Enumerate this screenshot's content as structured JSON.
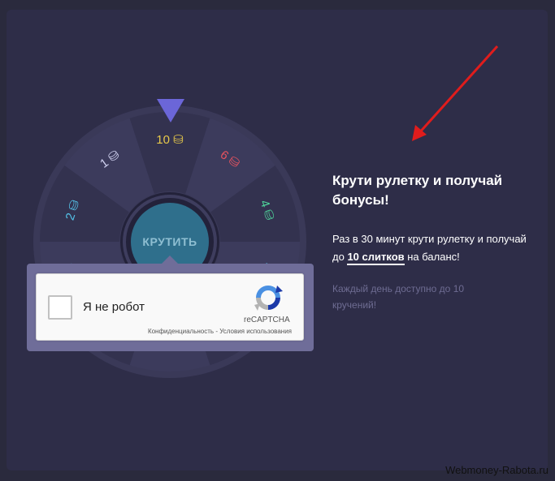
{
  "wheel": {
    "spin_label": "КРУТИТЬ",
    "segments": [
      {
        "label": "10",
        "color": "#e6c84a",
        "angle": 0
      },
      {
        "label": "6",
        "color": "#e6535f",
        "angle": 36
      },
      {
        "label": "4",
        "color": "#4fd49a",
        "angle": 72
      },
      {
        "label": "2",
        "color": "#54c2e8",
        "angle": 108
      },
      {
        "label": "",
        "color": "#54c2e8",
        "angle": 144
      },
      {
        "label": "",
        "color": "#54c2e8",
        "angle": 180
      },
      {
        "label": "",
        "color": "#54c2e8",
        "angle": 216
      },
      {
        "label": "1",
        "color": "#54c2e8",
        "angle": 252
      },
      {
        "label": "2",
        "color": "#54c2e8",
        "angle": 288
      },
      {
        "label": "1",
        "color": "#cfd0ef",
        "angle": 324
      }
    ]
  },
  "captcha": {
    "label": "Я не робот",
    "brand": "reCAPTCHA",
    "privacy": "Конфиденциальность",
    "separator": " - ",
    "terms": "Условия использования"
  },
  "promo": {
    "title": "Крути рулетку и получай бонусы!",
    "desc_before": "Раз в 30 минут крути рулетку и получай до ",
    "desc_bold": "10 слитков",
    "desc_after": " на баланс!",
    "note": "Каждый день доступно до 10 кручений!"
  },
  "watermark": "Webmoney-Rabota.ru",
  "colors": {
    "background": "#2e2d48",
    "accent": "#6b66d8",
    "arrow": "#e01c1c"
  }
}
